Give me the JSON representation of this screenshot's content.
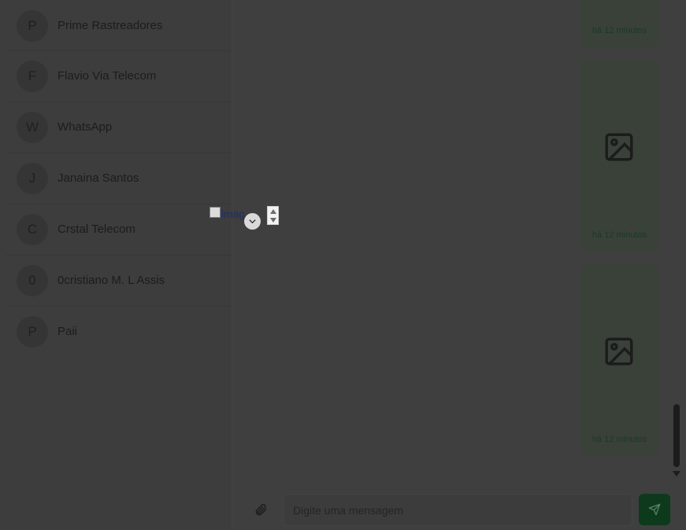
{
  "contacts": [
    {
      "initial": "P",
      "name": "Prime Rastreadores"
    },
    {
      "initial": "F",
      "name": "Flavio Via Telecom"
    },
    {
      "initial": "W",
      "name": "WhatsApp"
    },
    {
      "initial": "J",
      "name": "Janaina Santos"
    },
    {
      "initial": "C",
      "name": "Crstal Telecom"
    },
    {
      "initial": "0",
      "name": "0cristiano M. L Assis"
    },
    {
      "initial": "P",
      "name": "Paii"
    }
  ],
  "messages": [
    {
      "time": "há 12 minutos",
      "icon": "image-icon"
    },
    {
      "time": "há 12 minutos",
      "icon": "image-icon"
    },
    {
      "time": "há 12 minutos",
      "icon": "image-icon"
    }
  ],
  "broken_image": {
    "alt": "imagem"
  },
  "composer": {
    "placeholder": "Digite uma mensagem",
    "attach_icon": "paperclip-icon",
    "send_icon": "send-icon"
  },
  "colors": {
    "accent": "#0d3a1b",
    "overlay_bg": "#3f3f3f",
    "message_bubble": "#394139"
  }
}
